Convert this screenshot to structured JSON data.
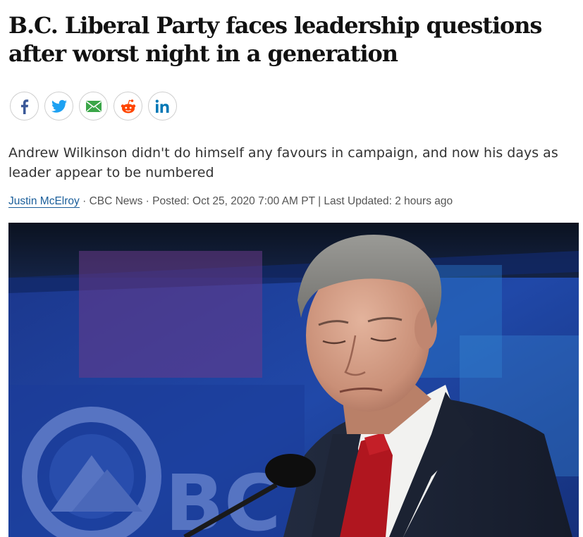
{
  "article": {
    "headline": "B.C. Liberal Party faces leadership questions after worst night in a generation",
    "deck": "Andrew Wilkinson didn't do himself any favours in campaign, and now his days as leader appear to be numbered",
    "byline": {
      "author": "Justin McElroy",
      "sep1": " · ",
      "source": "CBC News",
      "sep2": " · ",
      "posted": "Posted: Oct 25, 2020 7:00 AM PT",
      "sep3": " | ",
      "updated": "Last Updated: 2 hours ago"
    },
    "photo": {
      "backdrop_text": "BC L"
    }
  },
  "share": [
    {
      "name": "facebook-icon",
      "color": "#3b5998"
    },
    {
      "name": "twitter-icon",
      "color": "#1da1f2"
    },
    {
      "name": "email-icon",
      "color": "#3aa648"
    },
    {
      "name": "reddit-icon",
      "color": "#ff4500"
    },
    {
      "name": "linkedin-icon",
      "color": "#0077b5"
    }
  ],
  "colors": {
    "link": "#1a5e9a",
    "tie": "#b0161f",
    "suit": "#1c2435",
    "backdrop": "#1e3f9e"
  }
}
